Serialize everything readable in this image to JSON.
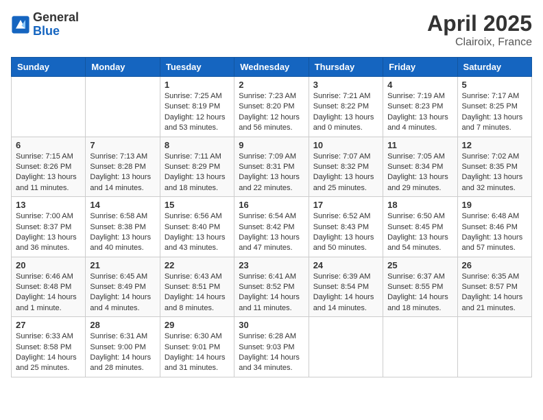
{
  "header": {
    "logo_general": "General",
    "logo_blue": "Blue",
    "month_year": "April 2025",
    "location": "Clairoix, France"
  },
  "days_of_week": [
    "Sunday",
    "Monday",
    "Tuesday",
    "Wednesday",
    "Thursday",
    "Friday",
    "Saturday"
  ],
  "weeks": [
    [
      {
        "day": "",
        "info": ""
      },
      {
        "day": "",
        "info": ""
      },
      {
        "day": "1",
        "info": "Sunrise: 7:25 AM\nSunset: 8:19 PM\nDaylight: 12 hours and 53 minutes."
      },
      {
        "day": "2",
        "info": "Sunrise: 7:23 AM\nSunset: 8:20 PM\nDaylight: 12 hours and 56 minutes."
      },
      {
        "day": "3",
        "info": "Sunrise: 7:21 AM\nSunset: 8:22 PM\nDaylight: 13 hours and 0 minutes."
      },
      {
        "day": "4",
        "info": "Sunrise: 7:19 AM\nSunset: 8:23 PM\nDaylight: 13 hours and 4 minutes."
      },
      {
        "day": "5",
        "info": "Sunrise: 7:17 AM\nSunset: 8:25 PM\nDaylight: 13 hours and 7 minutes."
      }
    ],
    [
      {
        "day": "6",
        "info": "Sunrise: 7:15 AM\nSunset: 8:26 PM\nDaylight: 13 hours and 11 minutes."
      },
      {
        "day": "7",
        "info": "Sunrise: 7:13 AM\nSunset: 8:28 PM\nDaylight: 13 hours and 14 minutes."
      },
      {
        "day": "8",
        "info": "Sunrise: 7:11 AM\nSunset: 8:29 PM\nDaylight: 13 hours and 18 minutes."
      },
      {
        "day": "9",
        "info": "Sunrise: 7:09 AM\nSunset: 8:31 PM\nDaylight: 13 hours and 22 minutes."
      },
      {
        "day": "10",
        "info": "Sunrise: 7:07 AM\nSunset: 8:32 PM\nDaylight: 13 hours and 25 minutes."
      },
      {
        "day": "11",
        "info": "Sunrise: 7:05 AM\nSunset: 8:34 PM\nDaylight: 13 hours and 29 minutes."
      },
      {
        "day": "12",
        "info": "Sunrise: 7:02 AM\nSunset: 8:35 PM\nDaylight: 13 hours and 32 minutes."
      }
    ],
    [
      {
        "day": "13",
        "info": "Sunrise: 7:00 AM\nSunset: 8:37 PM\nDaylight: 13 hours and 36 minutes."
      },
      {
        "day": "14",
        "info": "Sunrise: 6:58 AM\nSunset: 8:38 PM\nDaylight: 13 hours and 40 minutes."
      },
      {
        "day": "15",
        "info": "Sunrise: 6:56 AM\nSunset: 8:40 PM\nDaylight: 13 hours and 43 minutes."
      },
      {
        "day": "16",
        "info": "Sunrise: 6:54 AM\nSunset: 8:42 PM\nDaylight: 13 hours and 47 minutes."
      },
      {
        "day": "17",
        "info": "Sunrise: 6:52 AM\nSunset: 8:43 PM\nDaylight: 13 hours and 50 minutes."
      },
      {
        "day": "18",
        "info": "Sunrise: 6:50 AM\nSunset: 8:45 PM\nDaylight: 13 hours and 54 minutes."
      },
      {
        "day": "19",
        "info": "Sunrise: 6:48 AM\nSunset: 8:46 PM\nDaylight: 13 hours and 57 minutes."
      }
    ],
    [
      {
        "day": "20",
        "info": "Sunrise: 6:46 AM\nSunset: 8:48 PM\nDaylight: 14 hours and 1 minute."
      },
      {
        "day": "21",
        "info": "Sunrise: 6:45 AM\nSunset: 8:49 PM\nDaylight: 14 hours and 4 minutes."
      },
      {
        "day": "22",
        "info": "Sunrise: 6:43 AM\nSunset: 8:51 PM\nDaylight: 14 hours and 8 minutes."
      },
      {
        "day": "23",
        "info": "Sunrise: 6:41 AM\nSunset: 8:52 PM\nDaylight: 14 hours and 11 minutes."
      },
      {
        "day": "24",
        "info": "Sunrise: 6:39 AM\nSunset: 8:54 PM\nDaylight: 14 hours and 14 minutes."
      },
      {
        "day": "25",
        "info": "Sunrise: 6:37 AM\nSunset: 8:55 PM\nDaylight: 14 hours and 18 minutes."
      },
      {
        "day": "26",
        "info": "Sunrise: 6:35 AM\nSunset: 8:57 PM\nDaylight: 14 hours and 21 minutes."
      }
    ],
    [
      {
        "day": "27",
        "info": "Sunrise: 6:33 AM\nSunset: 8:58 PM\nDaylight: 14 hours and 25 minutes."
      },
      {
        "day": "28",
        "info": "Sunrise: 6:31 AM\nSunset: 9:00 PM\nDaylight: 14 hours and 28 minutes."
      },
      {
        "day": "29",
        "info": "Sunrise: 6:30 AM\nSunset: 9:01 PM\nDaylight: 14 hours and 31 minutes."
      },
      {
        "day": "30",
        "info": "Sunrise: 6:28 AM\nSunset: 9:03 PM\nDaylight: 14 hours and 34 minutes."
      },
      {
        "day": "",
        "info": ""
      },
      {
        "day": "",
        "info": ""
      },
      {
        "day": "",
        "info": ""
      }
    ]
  ]
}
